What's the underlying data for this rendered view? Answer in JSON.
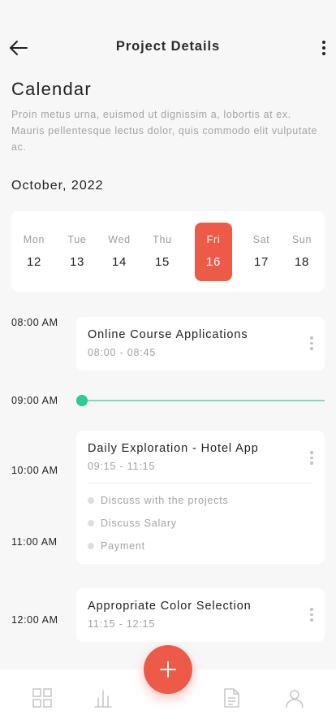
{
  "header": {
    "title": "Project Details",
    "back_icon": "arrow-left-icon",
    "more_icon": "more-vertical-icon"
  },
  "calendar": {
    "title": "Calendar",
    "description": "Proin metus urna, euismod ut dignissim a, lobortis at ex. Mauris pellentesque lectus dolor, quis commodo elit vulputate ac.",
    "month": "October, 2022",
    "days": [
      {
        "name": "Mon",
        "num": "12"
      },
      {
        "name": "Tue",
        "num": "13"
      },
      {
        "name": "Wed",
        "num": "14"
      },
      {
        "name": "Thu",
        "num": "15"
      },
      {
        "name": "Fri",
        "num": "16"
      },
      {
        "name": "Sat",
        "num": "17"
      },
      {
        "name": "Sun",
        "num": "18"
      }
    ],
    "selected_day_index": 4
  },
  "timeline": {
    "times": [
      "08:00 AM",
      "09:00 AM",
      "10:00 AM",
      "11:00 AM",
      "12:00 AM"
    ],
    "events": [
      {
        "title": "Online Course Applications",
        "range": "08:00 - 08:45"
      },
      {
        "title": "Daily Exploration - Hotel App",
        "range": "09:15 - 11:15",
        "tasks": [
          "Discuss with the projects",
          "Discuss Salary",
          "Payment"
        ]
      },
      {
        "title": "Appropriate Color Selection",
        "range": "11:15 - 12:15"
      }
    ]
  },
  "bottom_nav": {
    "items": [
      "grid-icon",
      "bar-chart-icon",
      "document-icon",
      "user-icon"
    ],
    "fab_icon": "plus-icon"
  },
  "colors": {
    "accent": "#ee5a48",
    "now_indicator": "#2ccb8f",
    "background": "#f7f7f7"
  }
}
